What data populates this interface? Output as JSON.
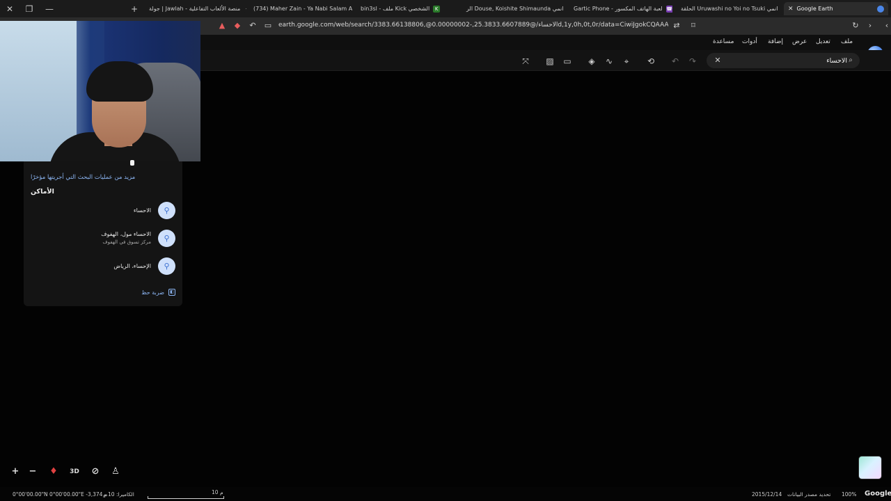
{
  "browser": {
    "tabs": [
      {
        "label": "جولة | Jawlah - منصة الألعاب التفاعلية",
        "favicon": "jawlah-icon",
        "active": false
      },
      {
        "label": "(734) Maher Zain - Ya Nabi Salam Al",
        "favicon": "youtube-icon",
        "active": false
      },
      {
        "label": "bin3sl - ملف Kick الشخصي",
        "favicon": "kick-icon",
        "active": false
      },
      {
        "label": "الر Douse, Koishite Shimaunda انمي",
        "favicon": "anime-icon",
        "active": false
      },
      {
        "label": "Gartic Phone - لعبة الهاتف المكسور",
        "favicon": "gartic-icon",
        "active": false
      },
      {
        "label": "الحلقة Uruwashi no Yoi no Tsuki انمي",
        "favicon": "anime-icon",
        "active": false
      },
      {
        "label": "Google Earth",
        "favicon": "google-earth-icon",
        "active": true
      }
    ],
    "url": "earth.google.com/web/search/الاحساء/@25.3833.6607889,-0.00000002@,3383.66138806d,1y,0h,0t,0r/data=CiwiJgokCQAAAAAAAAAEQAAAAAA..."
  },
  "earth": {
    "menu": [
      "ملف",
      "تعديل",
      "عرض",
      "إضافة",
      "أدوات",
      "مساعدة"
    ],
    "search": {
      "value": "الاحساء"
    },
    "suggestions": {
      "recent_link": "مزيد من عمليات البحث التي أجريتها مؤخرًا",
      "places_heading": "الأماكن",
      "places": [
        {
          "name": "الاحساء",
          "subtitle": ""
        },
        {
          "name": "الاحساء مول، الهفوف",
          "subtitle": "مركز تسوق في الهفوف"
        },
        {
          "name": "الإحساء، الرياض",
          "subtitle": ""
        }
      ],
      "shortcut_label": "ضربة حظ"
    },
    "map_controls": {
      "three_d": "3D"
    },
    "status": {
      "coords": "0°00'00.00\"N 0°00'00.00\"E -3,374 م",
      "camera": "الكاميرا: 10 م",
      "scale": "10 م",
      "date": "2015/12/14",
      "data_source": "تحديد مصدر البيانات",
      "zoom": "100%",
      "logo": "Google"
    }
  }
}
